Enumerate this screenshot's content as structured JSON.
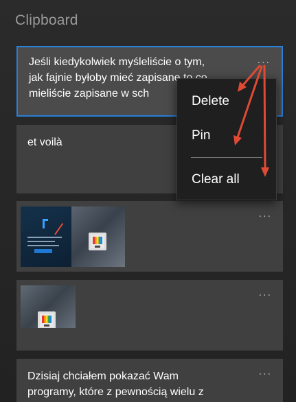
{
  "header": {
    "title": "Clipboard"
  },
  "items": [
    {
      "text": "Jeśli kiedykolwiek myśleliście o tym,\njak fajnie byłoby mieć zapisane to co\nmieliście zapisane w sch",
      "more_label": "..."
    },
    {
      "text": "et voilà",
      "more_label": "..."
    },
    {
      "more_label": "..."
    },
    {
      "more_label": "..."
    },
    {
      "text": "Dzisiaj chciałem pokazać Wam\nprogramy, które z pewnością wielu z",
      "more_label": "..."
    }
  ],
  "context_menu": {
    "items": [
      "Delete",
      "Pin",
      "Clear all"
    ]
  },
  "colors": {
    "accent": "#2a7fd8",
    "annotation_arrow": "#e04a35",
    "card": "#404040",
    "menu": "#1f1f1f"
  }
}
